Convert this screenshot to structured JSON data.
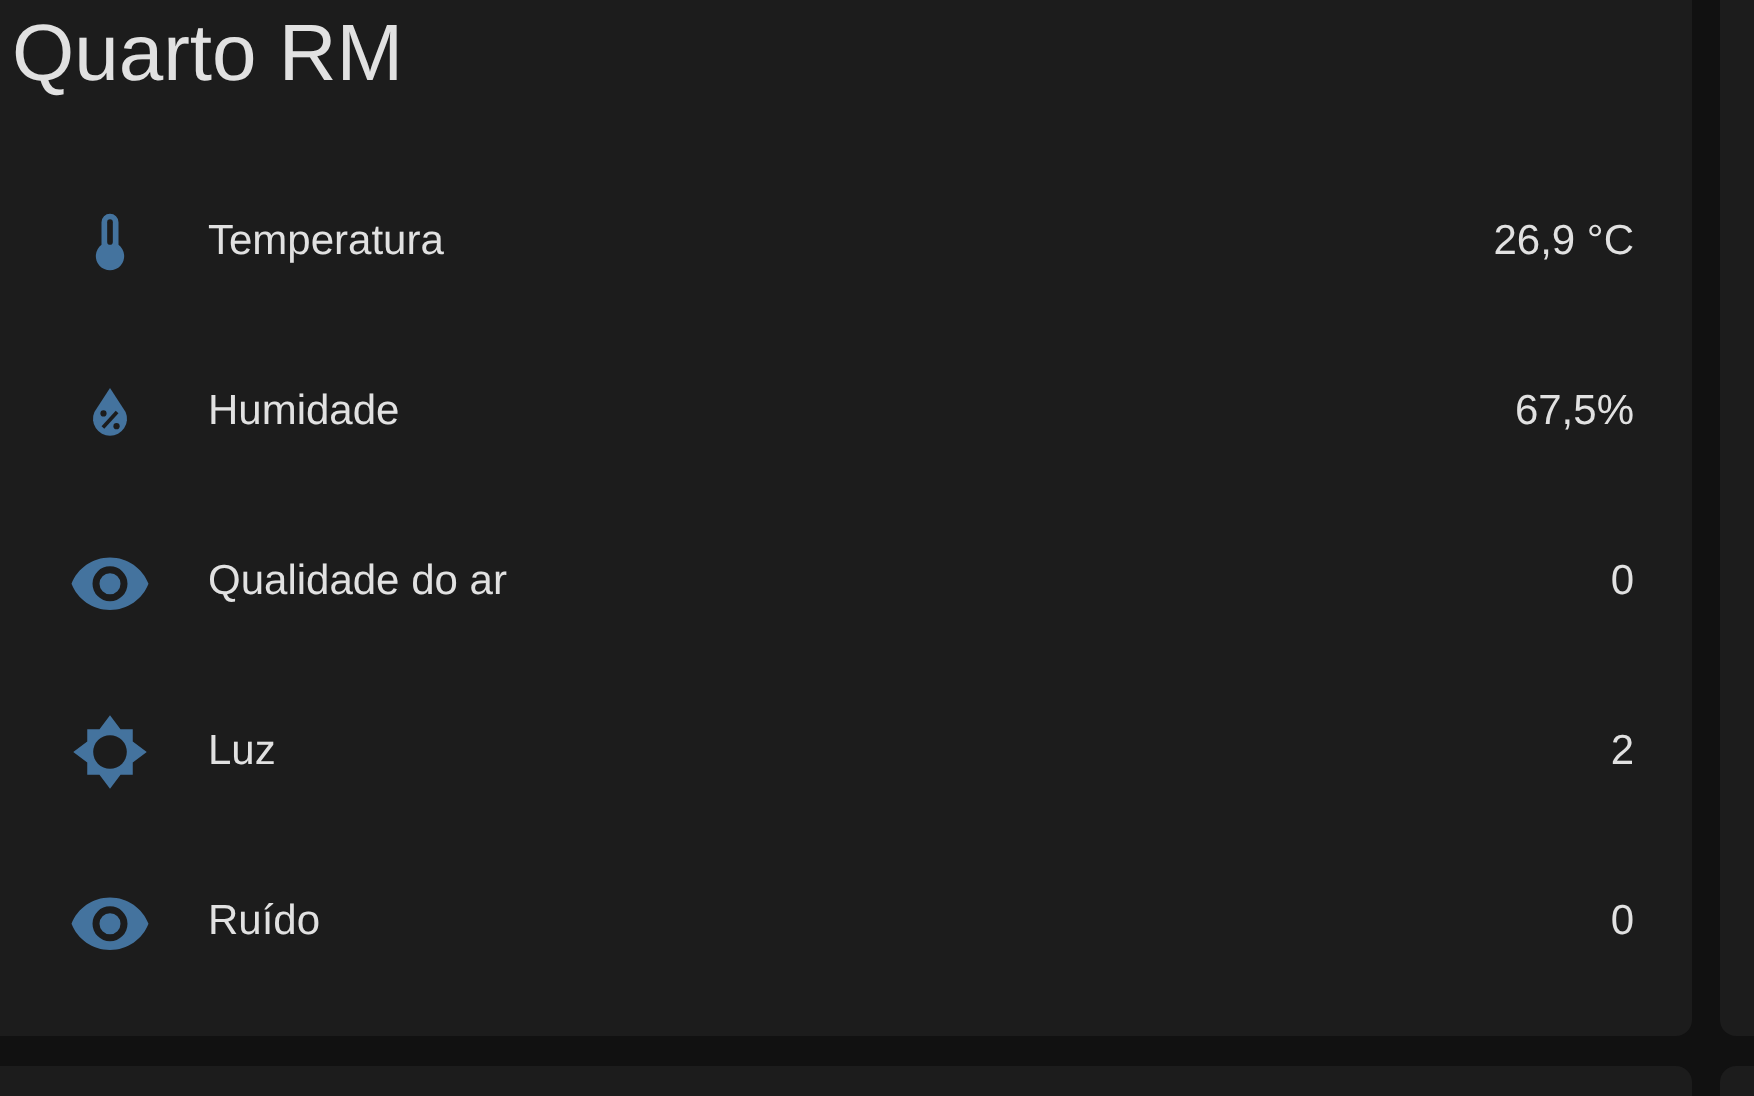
{
  "card": {
    "title": "Quarto RM",
    "rows": [
      {
        "kind": "thermometer",
        "name": "Temperatura",
        "value": "26,9 °C"
      },
      {
        "kind": "humidity",
        "name": "Humidade",
        "value": "67,5%"
      },
      {
        "kind": "eye",
        "name": "Qualidade do ar",
        "value": "0"
      },
      {
        "kind": "light",
        "name": "Luz",
        "value": "2"
      },
      {
        "kind": "eye",
        "name": "Ruído",
        "value": "0"
      }
    ]
  }
}
